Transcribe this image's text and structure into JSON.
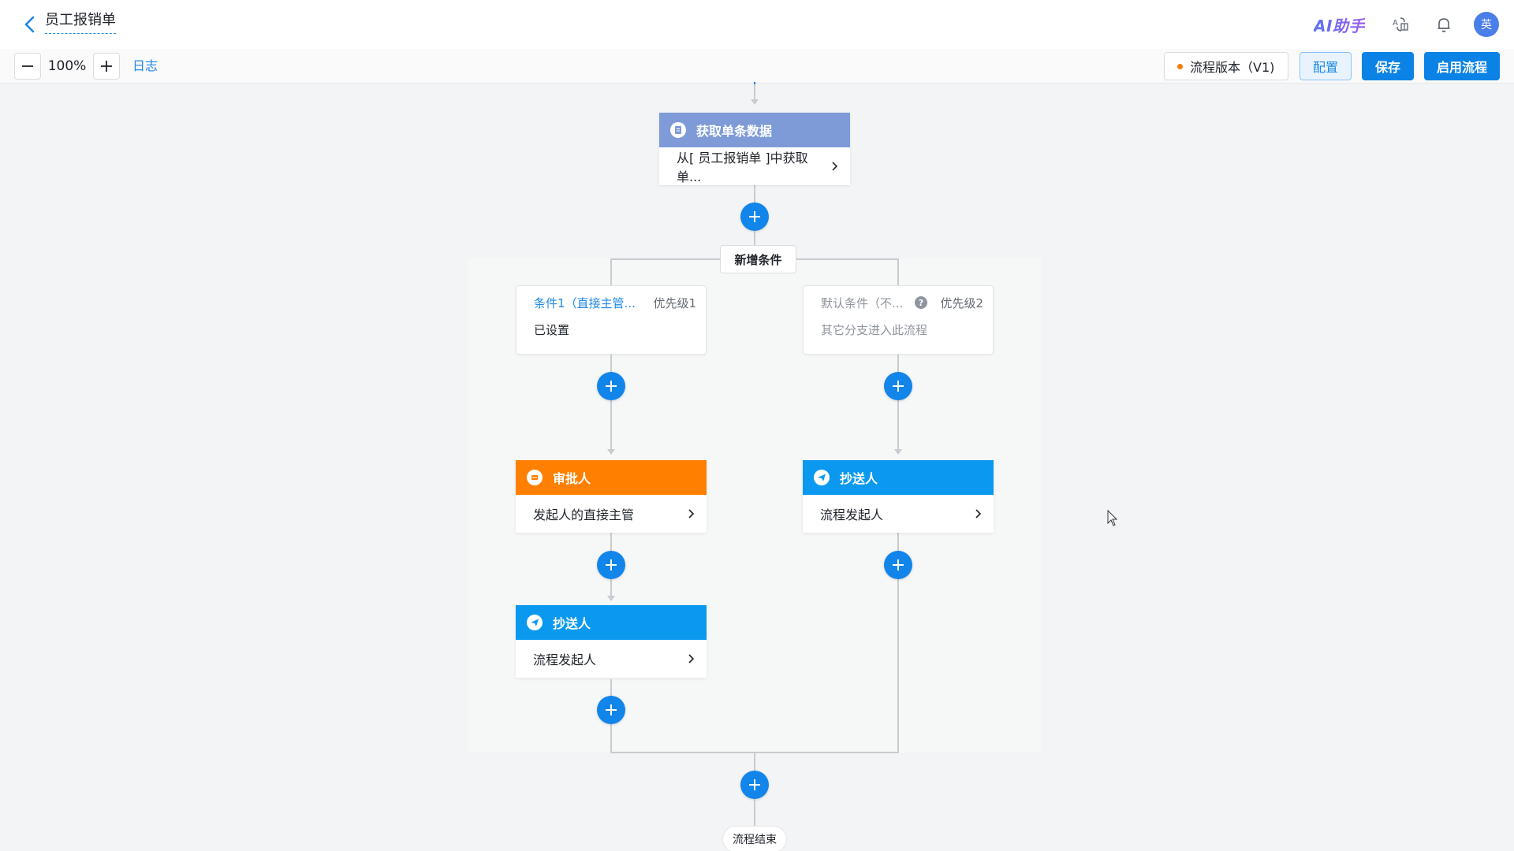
{
  "header": {
    "title": "员工报销单",
    "ai_helper": "AI助手",
    "avatar_text": "英"
  },
  "toolbar": {
    "zoom": "100%",
    "log": "日志",
    "version": "流程版本（V1)",
    "config": "配置",
    "save": "保存",
    "enable": "启用流程"
  },
  "flow": {
    "get_data": {
      "title": "获取单条数据",
      "detail": "从[ 员工报销单 ]中获取单..."
    },
    "add_condition": "新增条件",
    "conditions": [
      {
        "title": "条件1（直接主管...",
        "priority": "优先级1",
        "desc": "已设置"
      },
      {
        "title": "默认条件（不...",
        "priority": "优先级2",
        "desc": "其它分支进入此流程"
      }
    ],
    "approver": {
      "title": "审批人",
      "detail": "发起人的直接主管"
    },
    "cc_left": {
      "title": "抄送人",
      "detail": "流程发起人"
    },
    "cc_right": {
      "title": "抄送人",
      "detail": "流程发起人"
    },
    "end": "流程结束"
  },
  "colors": {
    "primary": "#1185ea",
    "data_node": "#7e9bd8",
    "approver_node": "#ff7f00",
    "cc_node": "#0b99f0",
    "condition_title": "#1e88e5"
  }
}
